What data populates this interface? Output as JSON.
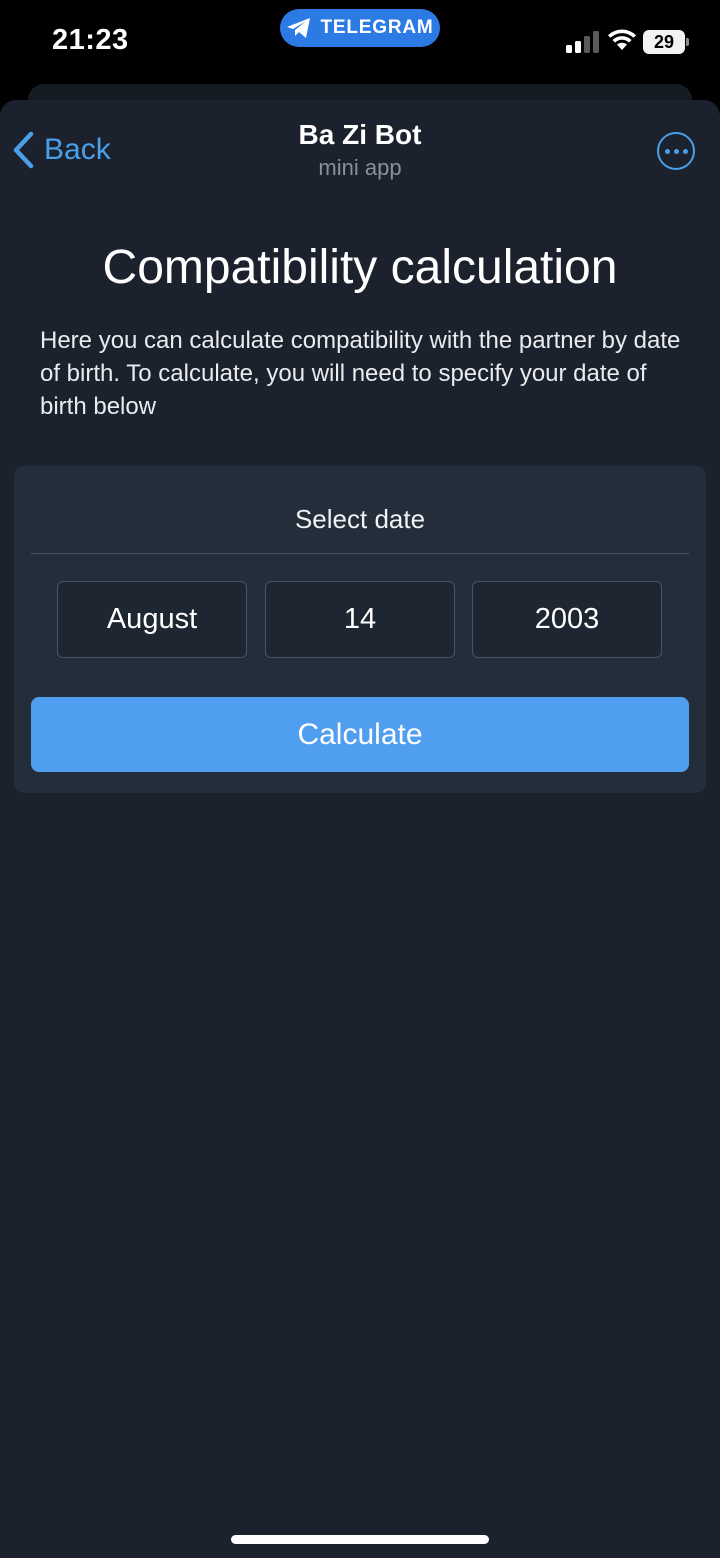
{
  "status_bar": {
    "time": "21:23",
    "app_pill": "TELEGRAM",
    "battery": "29",
    "icons": [
      "telegram-icon",
      "cellular-signal-icon",
      "wifi-icon",
      "battery-icon"
    ]
  },
  "header": {
    "back_label": "Back",
    "title": "Ba Zi Bot",
    "subtitle": "mini app",
    "icons": [
      "chevron-left-icon",
      "more-icon"
    ]
  },
  "main": {
    "title": "Compatibility calculation",
    "description": "Here you can calculate compatibility with the partner by date of birth. To calculate, you will need to specify your date of birth below",
    "date_picker": {
      "label": "Select date",
      "month": "August",
      "day": "14",
      "year": "2003"
    },
    "calculate_label": "Calculate"
  },
  "colors": {
    "background": "#1b222d",
    "card": "#242d3a",
    "accent": "#4b9fe8",
    "button": "#509ef0",
    "telegram_pill": "#2c7be5"
  }
}
